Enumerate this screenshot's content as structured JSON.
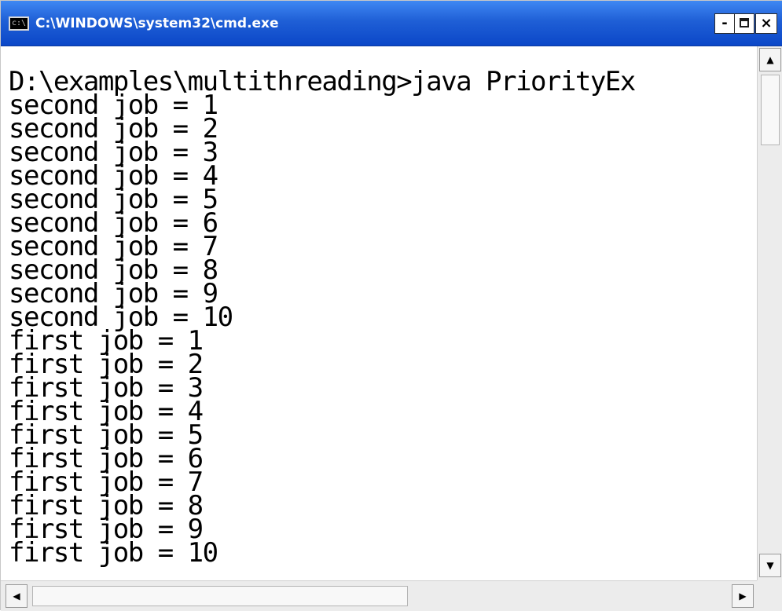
{
  "window": {
    "title": "C:\\WINDOWS\\system32\\cmd.exe",
    "icon": "cmd-icon",
    "icon_glyph": "c:\\",
    "minimize_label": "-",
    "close_label": "×"
  },
  "console": {
    "lines": [
      "D:\\examples\\multithreading>java PriorityEx",
      "second job = 1",
      "second job = 2",
      "second job = 3",
      "second job = 4",
      "second job = 5",
      "second job = 6",
      "second job = 7",
      "second job = 8",
      "second job = 9",
      "second job = 10",
      "first job = 1",
      "first job = 2",
      "first job = 3",
      "first job = 4",
      "first job = 5",
      "first job = 6",
      "first job = 7",
      "first job = 8",
      "first job = 9",
      "first job = 10"
    ]
  },
  "scrollbars": {
    "up_glyph": "▲",
    "down_glyph": "▼",
    "left_glyph": "◀",
    "right_glyph": "▶"
  },
  "colors": {
    "titlebar": "#1f5fd6",
    "console_bg": "#ffffff",
    "console_text": "#000000"
  }
}
